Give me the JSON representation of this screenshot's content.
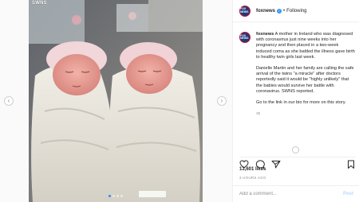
{
  "post": {
    "watermark": "SWNS",
    "image_description_name": "newborn-twins-photo",
    "carousel": {
      "count": 4,
      "active": 0
    }
  },
  "account": {
    "handle": "foxnews",
    "avatar_text": "FOX NEWS",
    "separator": "•",
    "follow_state": "Following",
    "brand_color": "#1f3b7a",
    "accent_color": "#c8102e"
  },
  "caption": {
    "handle": "foxnews",
    "paragraphs": [
      "A mother in Ireland who was diagnosed with coronavirus just nine weeks into her pregnancy and then placed in a two-week induced coma as she battled the illness gave birth to healthy twin girls last week.",
      "Danielle Martin and her family are calling the safe arrival of the twins \"a miracle\" after doctors reportedly said it would be \"highly unlikely\" that the babies would survive her battle with coronavirus. SWNS reported.",
      "Go to the link in our bio for more on this story."
    ],
    "age": "3h"
  },
  "actions": {
    "like_icon": "heart-icon",
    "comment_icon": "comment-icon",
    "share_icon": "share-icon",
    "save_icon": "bookmark-icon"
  },
  "stats": {
    "likes": "13,601 likes",
    "posted": "3 HOURS AGO"
  },
  "comment": {
    "placeholder": "Add a comment...",
    "post_label": "Post"
  },
  "nav": {
    "prev": "‹",
    "next": "›"
  }
}
